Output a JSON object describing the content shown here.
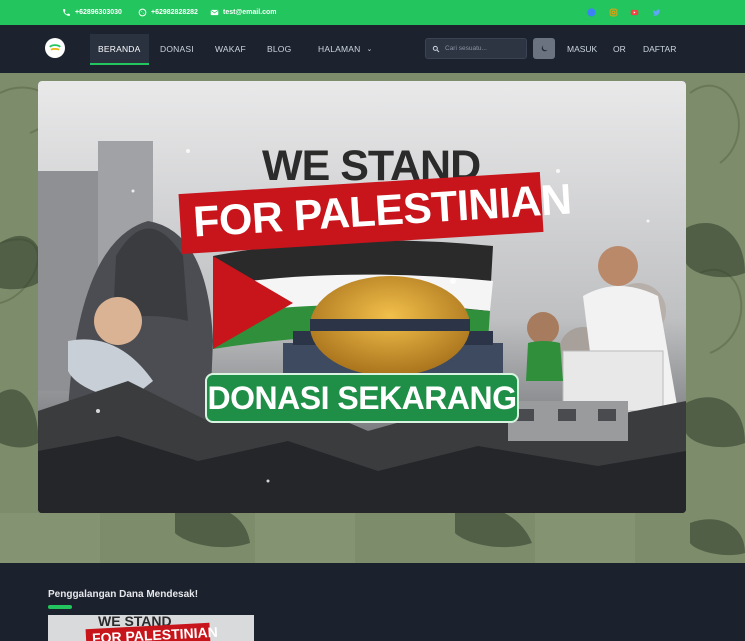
{
  "topbar": {
    "phone": "+62896303030",
    "whatsapp": "+62982828282",
    "email": "test@email.com",
    "social_icons": [
      "facebook-icon",
      "instagram-icon",
      "youtube-icon",
      "twitter-icon"
    ]
  },
  "nav": {
    "items": [
      {
        "label": "BERANDA",
        "active": true
      },
      {
        "label": "DONASI"
      },
      {
        "label": "WAKAF"
      },
      {
        "label": "BLOG"
      },
      {
        "label": "HALAMAN"
      }
    ],
    "search_placeholder": "Cari sesuatu...",
    "login": "MASUK",
    "or": "OR",
    "register": "DAFTAR"
  },
  "hero": {
    "line1": "WE STAND",
    "line2": "FOR PALESTINIAN",
    "cta": "DONASI SEKARANG"
  },
  "section": {
    "title": "Penggalangan Dana Mendesak!",
    "card_line1": "WE STAND",
    "card_line2": "FOR PALESTINIAN"
  },
  "colors": {
    "accent": "#22c55e",
    "nav_bg": "#1d232e",
    "hero_bg": "#7d8c6a",
    "banner_red": "#c8141b",
    "cta_green": "#1f8f48"
  }
}
